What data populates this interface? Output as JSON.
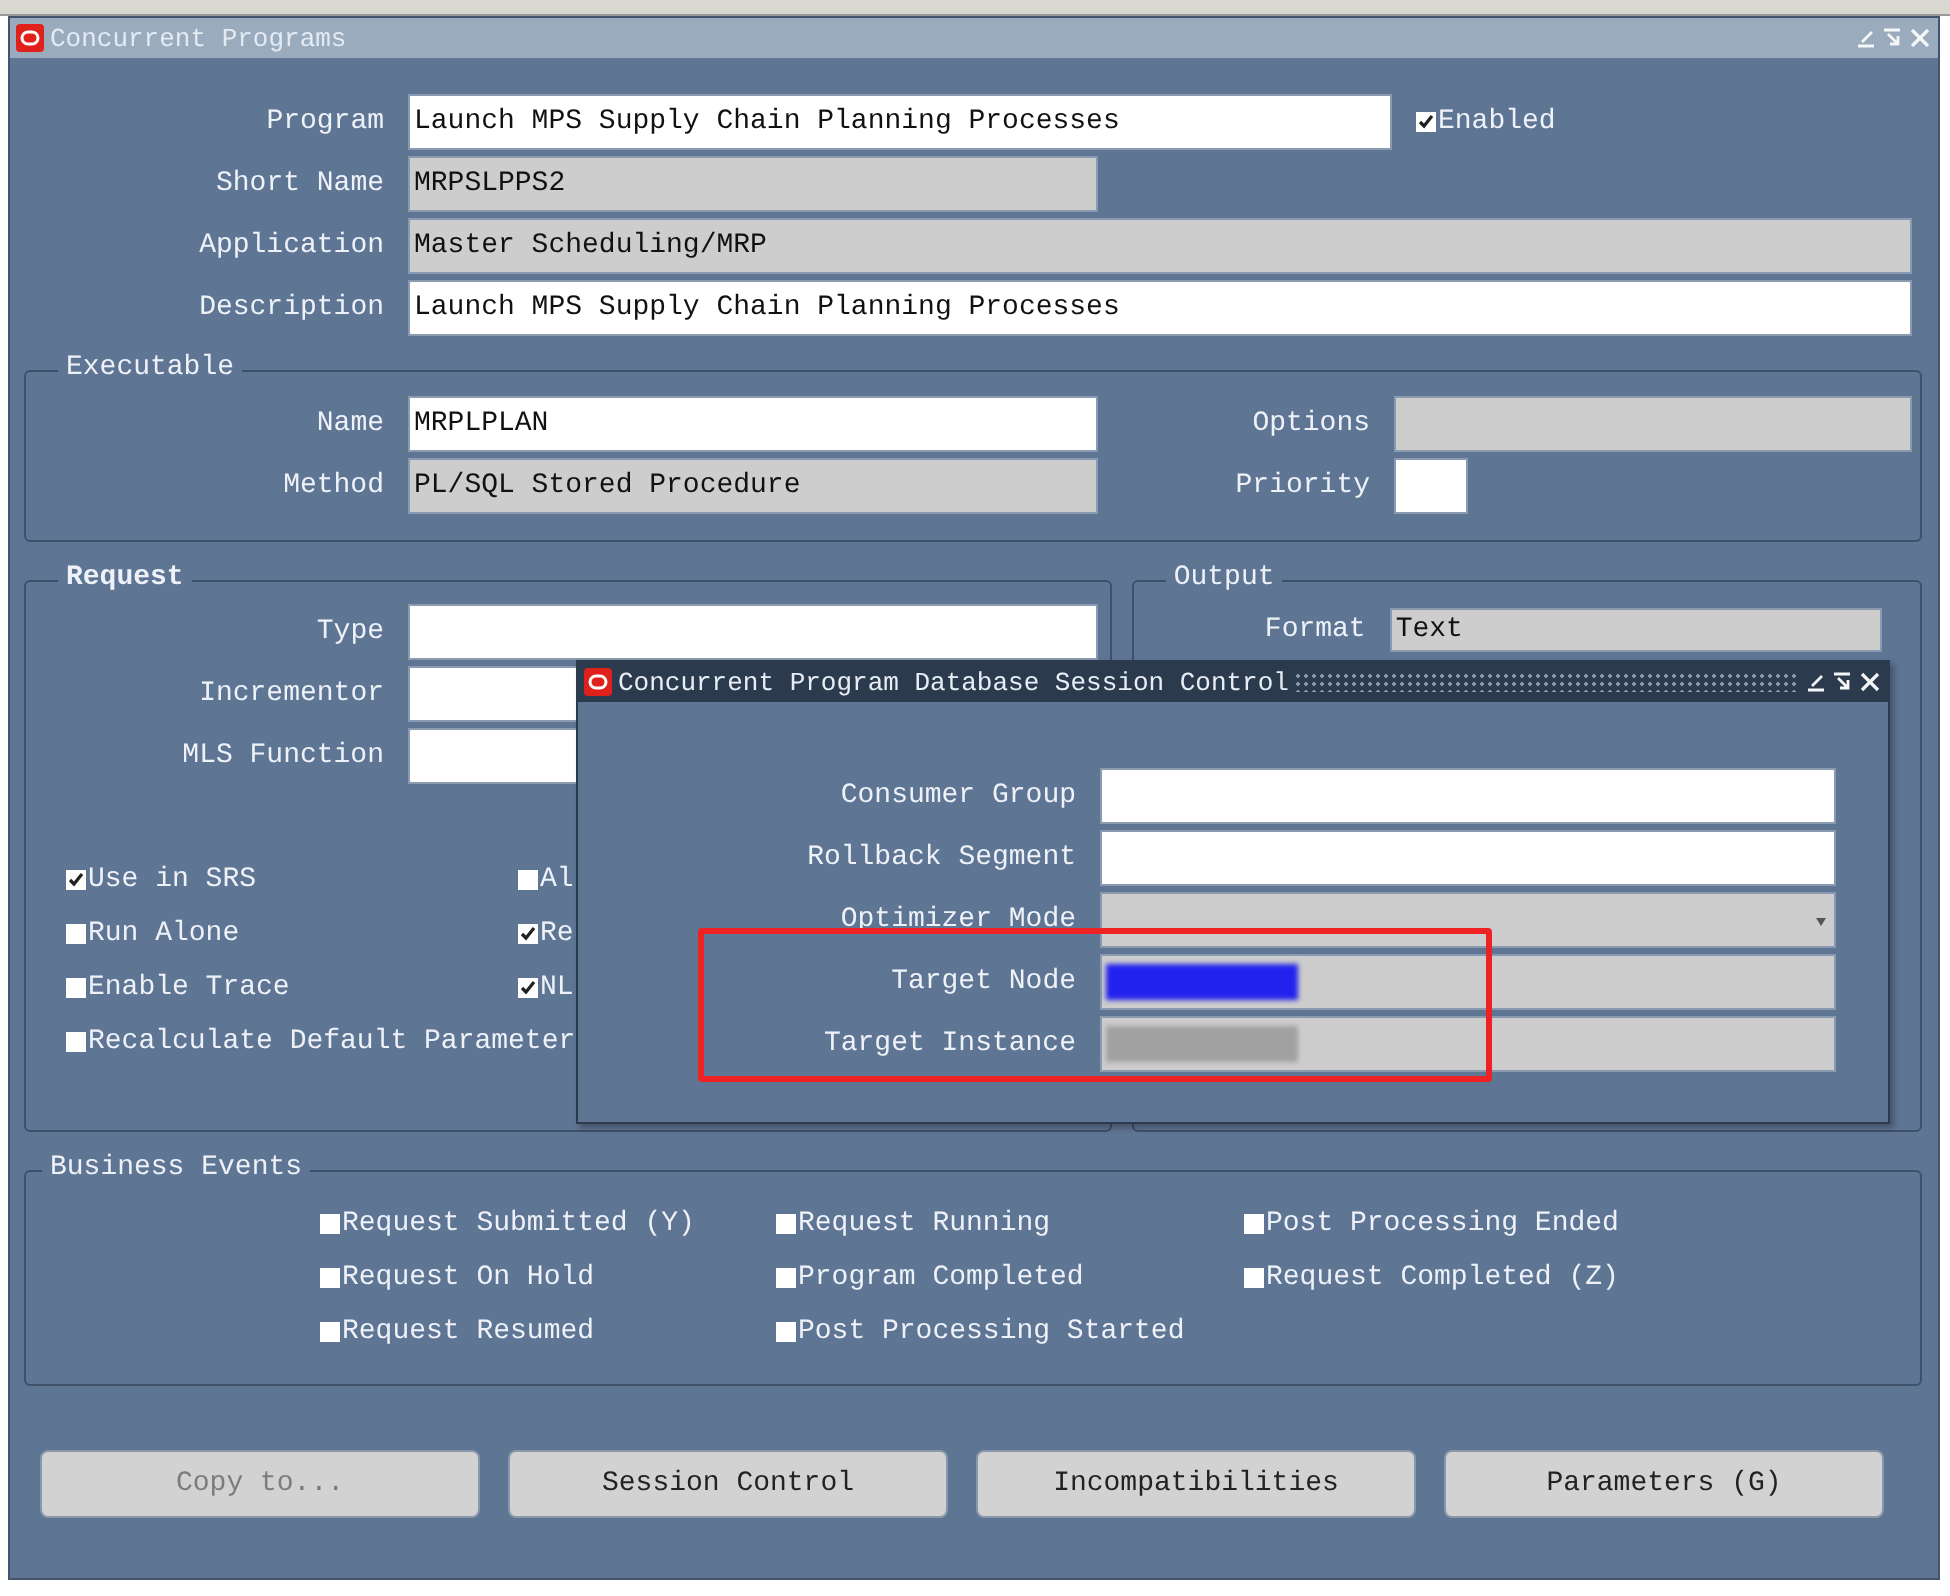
{
  "window": {
    "title": "Concurrent Programs"
  },
  "header": {
    "fields": [
      {
        "label": "Program",
        "value": "Launch MPS Supply Chain Planning Processes",
        "kind": "input"
      },
      {
        "label": "Short Name",
        "value": "MRPSLPPS2",
        "kind": "display"
      },
      {
        "label": "Application",
        "value": "Master Scheduling/MRP",
        "kind": "display"
      },
      {
        "label": "Description",
        "value": "Launch MPS Supply Chain Planning Processes",
        "kind": "input"
      }
    ],
    "enabled": {
      "label": "Enabled",
      "checked": true
    }
  },
  "executable": {
    "title": "Executable",
    "fields": [
      {
        "label": "Name",
        "value": "MRPLPLAN",
        "kind": "input"
      },
      {
        "label": "Method",
        "value": "PL/SQL Stored Procedure",
        "kind": "display"
      }
    ],
    "side_fields": [
      {
        "label": "Options",
        "kind": "display"
      },
      {
        "label": "Priority",
        "kind": "input"
      }
    ]
  },
  "request": {
    "title": "Request",
    "fields": [
      {
        "label": "Type",
        "kind": "input"
      },
      {
        "label": "Incrementor",
        "kind": "input"
      },
      {
        "label": "MLS Function",
        "kind": "input"
      }
    ],
    "checkboxes": [
      {
        "label": "Use in SRS",
        "checked": true
      },
      {
        "label": "Run Alone",
        "checked": false
      },
      {
        "label": "Enable Trace",
        "checked": false
      },
      {
        "label": "Recalculate Default Parameter",
        "checked": false
      }
    ],
    "checkboxes_2": [
      {
        "label": "Al",
        "checked": false
      },
      {
        "label": "Re",
        "checked": true
      },
      {
        "label": "NL",
        "checked": true
      }
    ]
  },
  "output": {
    "title": "Output",
    "format": {
      "label": "Format",
      "value": "Text"
    }
  },
  "business_events": {
    "title": "Business Events",
    "columns": [
      [
        {
          "label": "Request Submitted (Y)",
          "checked": false
        },
        {
          "label": "Request On Hold",
          "checked": false
        },
        {
          "label": "Request Resumed",
          "checked": false
        }
      ],
      [
        {
          "label": "Request Running",
          "checked": false
        },
        {
          "label": "Program Completed",
          "checked": false
        },
        {
          "label": "Post Processing Started",
          "checked": false
        }
      ],
      [
        {
          "label": "Post Processing Ended",
          "checked": false
        },
        {
          "label": "Request Completed (Z)",
          "checked": false
        }
      ]
    ]
  },
  "buttons": [
    {
      "label": "Copy to...",
      "disabled": true
    },
    {
      "label": "Session Control",
      "disabled": false
    },
    {
      "label": "Incompatibilities",
      "disabled": false
    },
    {
      "label": "Parameters (G)",
      "disabled": false
    }
  ],
  "dialog": {
    "title": "Concurrent Program Database Session Control",
    "fields": [
      {
        "label": "Consumer Group",
        "kind": "input"
      },
      {
        "label": "Rollback Segment",
        "kind": "input"
      },
      {
        "label": "Optimizer Mode",
        "kind": "dropdown"
      },
      {
        "label": "Target Node",
        "kind": "display",
        "redacted": true,
        "color": "#2222ee"
      },
      {
        "label": "Target Instance",
        "kind": "display",
        "redacted": true,
        "color": "#a0a0a0"
      }
    ]
  }
}
